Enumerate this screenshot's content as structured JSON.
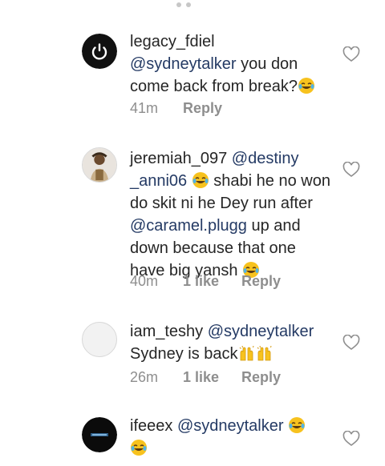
{
  "comments": [
    {
      "username": "legacy_fdiel",
      "mention": "@sydneytalker",
      "text_1": " you don come back from break?",
      "time": "41m",
      "reply_label": "Reply"
    },
    {
      "username": "jeremiah_097",
      "mention_1": "@destiny _anni06",
      "text_1": " shabi he no won do skit ni he Dey run after ",
      "mention_2": "@caramel.plugg",
      "text_2": "  up and down because that one have big yansh ",
      "time": "40m",
      "likes": "1 like",
      "reply_label": "Reply"
    },
    {
      "username": "iam_teshy",
      "mention": "@sydneytalker",
      "text_1": "Sydney is back",
      "time": "26m",
      "likes": "1 like",
      "reply_label": "Reply"
    },
    {
      "username": "ifeeex",
      "mention": "@sydneytalker"
    }
  ],
  "icons": {
    "emoji": "face-with-tears-of-joy",
    "clap": "raising-hands",
    "like": "heart-outline",
    "avatar_1": "power-icon"
  },
  "colors": {
    "mention": "#243a64",
    "muted": "#8e8e8e",
    "text": "#262626"
  }
}
